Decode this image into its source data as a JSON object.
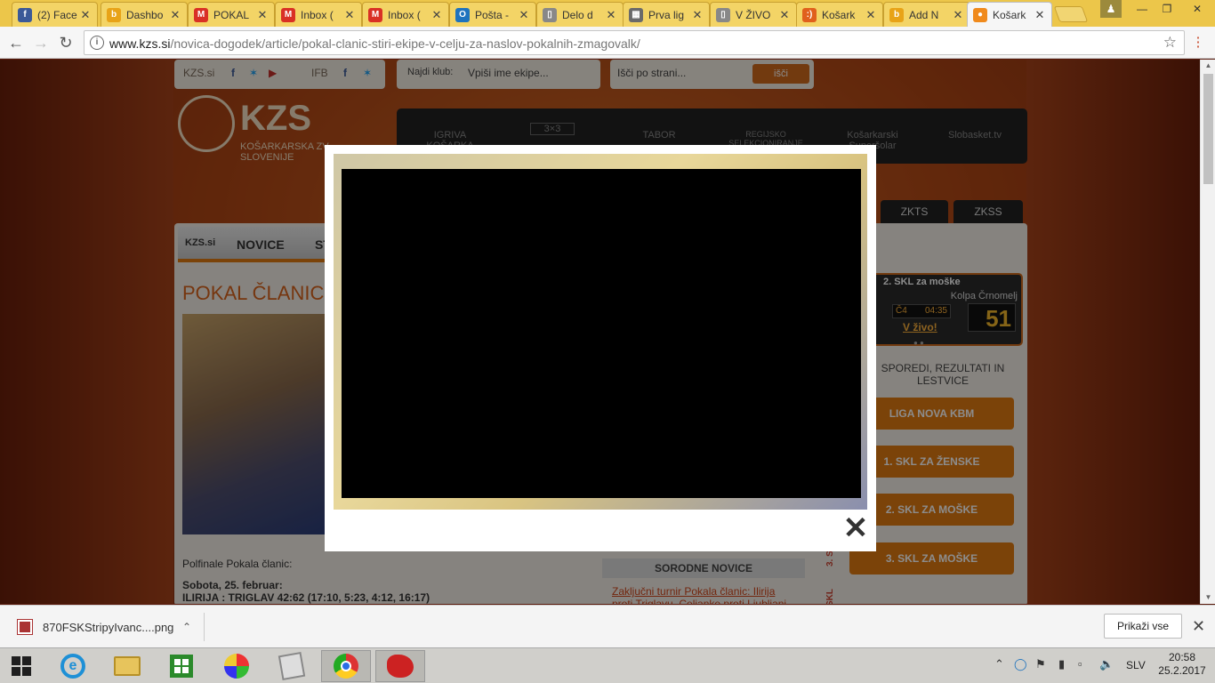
{
  "browser": {
    "tabs": [
      {
        "title": "(2) Face",
        "fav": "f",
        "color": "#3b5998"
      },
      {
        "title": "Dashbo",
        "fav": "b",
        "color": "#e8a317"
      },
      {
        "title": "POKAL",
        "fav": "M",
        "color": "#d93025"
      },
      {
        "title": "Inbox (",
        "fav": "M",
        "color": "#d93025"
      },
      {
        "title": "Inbox (",
        "fav": "M",
        "color": "#d93025"
      },
      {
        "title": "Pošta -",
        "fav": "O",
        "color": "#1e73be"
      },
      {
        "title": "Delo d",
        "fav": "▯",
        "color": "#888888"
      },
      {
        "title": "Prva lig",
        "fav": "▦",
        "color": "#6a6a6a"
      },
      {
        "title": "V ŽIVO",
        "fav": "▯",
        "color": "#888888"
      },
      {
        "title": "Košark",
        "fav": ":)",
        "color": "#e0601c"
      },
      {
        "title": "Add N",
        "fav": "b",
        "color": "#e8a317"
      },
      {
        "title": "Košark",
        "fav": "●",
        "color": "#f08a1c",
        "active": true
      }
    ],
    "url_host": "www.kzs.si",
    "url_path": "/novica-dogodek/article/pokal-clanic-stiri-ekipe-v-celju-za-naslov-pokalnih-zmagovalk/"
  },
  "page": {
    "top_links": "KZS.si",
    "ifb": "IFB",
    "club_label": "Najdi klub:",
    "club_placeholder": "Vpiši ime ekipe...",
    "search_placeholder": "Išči po strani...",
    "search_button": "išči",
    "logo": "KZS",
    "logo_sub1": "KOŠARKARSKA ZV",
    "logo_sub2": "SLOVENIJE",
    "navband": [
      "IGRIVA KOŠARKA",
      "3×3",
      "TABOR",
      "REGIJSKO SELEKCIONIRANJE",
      "Košarkarski Superšolar",
      "Slobasket.tv"
    ],
    "subtabs": [
      "ZKTS",
      "ZKSS"
    ],
    "mainnav": [
      "KZS.si",
      "NOVICE",
      "ST"
    ],
    "article_title": "POKAL ČLANIC:",
    "article_line1": "Polfinale Pokala članic:",
    "article_line2": "Sobota, 25. februar:",
    "article_line3": "ILIRIJA : TRIGLAV 42:62 (17:10, 5:23, 4:12, 16:17)",
    "related_title": "SORODNE NOVICE",
    "related_link": "Zaključni turnir Pokala članic: Ilirija proti Triglavu, Celjanke proti Ljubljani",
    "live": {
      "league": "2. SKL za moške",
      "team": "Kolpa Črnomelj",
      "quarter": "Č4",
      "time": "04:35",
      "score": "51",
      "link": "V živo!"
    },
    "leagues_title": "SPOREDI, REZULTATI IN LESTVICE",
    "leagues": [
      "LIGA NOVA KBM",
      "1. SKL ZA ŽENSKE",
      "2. SKL ZA MOŠKE",
      "3. SKL ZA MOŠKE"
    ],
    "side_labels": [
      "3. SK",
      "SKL"
    ]
  },
  "modal": {
    "close_label": "✕"
  },
  "downloads": {
    "file": "870FSKStripyIvanc....png",
    "show_all": "Prikaži vse"
  },
  "taskbar": {
    "lang": "SLV",
    "time": "20:58",
    "date": "25.2.2017"
  }
}
